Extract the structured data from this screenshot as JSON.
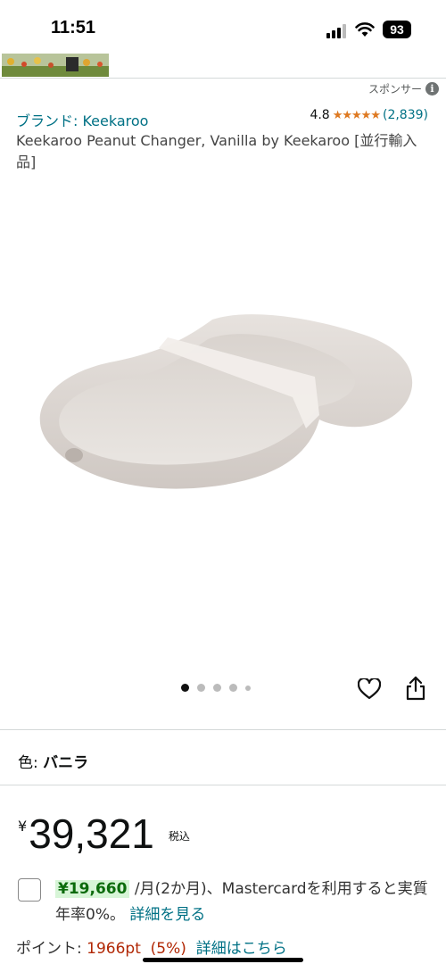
{
  "status_bar": {
    "time": "11:51",
    "battery": "93",
    "signal_icon": "cellular-signal-icon",
    "wifi_icon": "wifi-icon"
  },
  "ad": {
    "image_icon": "banner-ad-image",
    "sponsor_label": "スポンサー",
    "info_icon": "i"
  },
  "product": {
    "brand": "ブランド: Keekaroo",
    "rating_value": "4.8",
    "stars": "★★★★★",
    "rating_count": "(2,839)",
    "title": "Keekaroo Peanut Changer, Vanilla by Keekaroo [並行輸入品]",
    "image_icon": "peanut-changer-product-image",
    "carousel": {
      "total": 5,
      "active": 0
    },
    "heart_icon": "heart-icon",
    "share_icon": "share-icon"
  },
  "color": {
    "label": "色: ",
    "value": "バニラ"
  },
  "price": {
    "currency": "¥",
    "value": "39,321",
    "tax": "税込"
  },
  "installment": {
    "amount": "¥19,660",
    "text_after_amount": " /月(2か月)、Mastercardを利用すると実質年率0%。 ",
    "details_link": "詳細を見る"
  },
  "points": {
    "label": "ポイント: ",
    "value": "1966pt  (5%)",
    "link": "  詳細はこちら"
  },
  "colors": {
    "link": "#007185",
    "star": "#de7921",
    "points": "#b12704",
    "monthly_bg": "#d7f5d7"
  }
}
